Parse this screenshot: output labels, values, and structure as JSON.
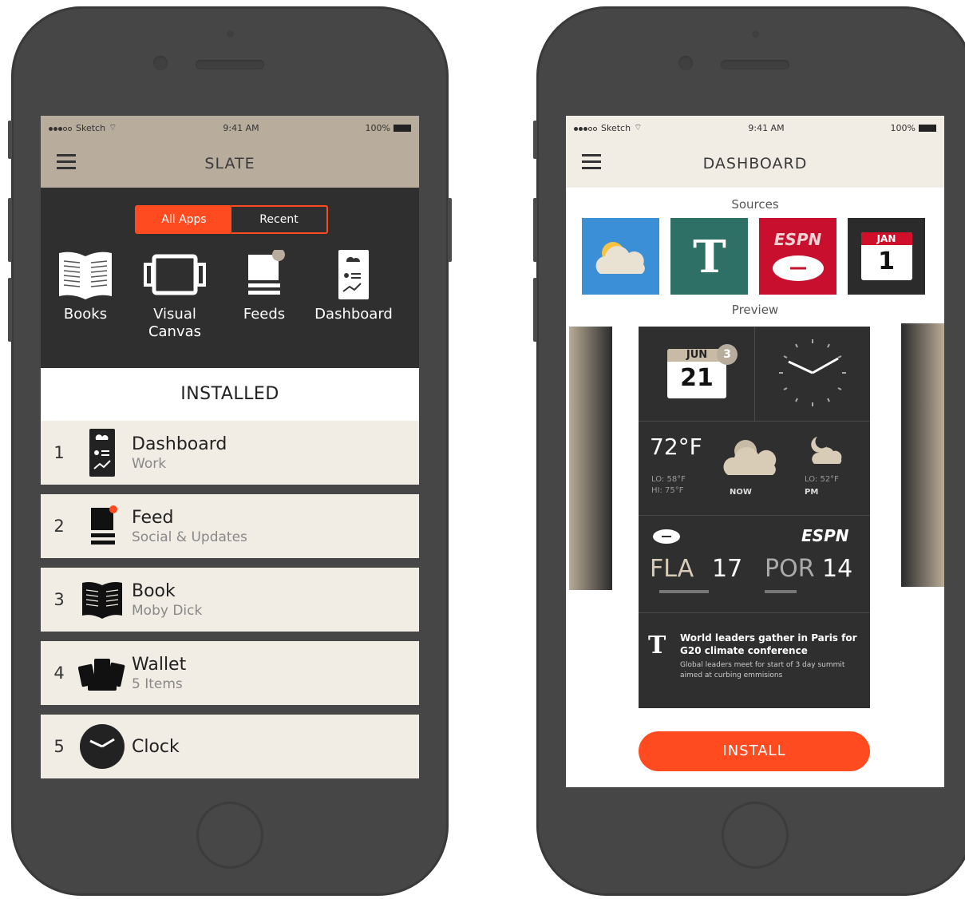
{
  "left_phone": {
    "status": {
      "carrier": "Sketch",
      "time": "9:41 AM",
      "battery": "100%"
    },
    "title": "SLATE",
    "segment": {
      "all_apps": "All Apps",
      "recent": "Recent"
    },
    "apps": [
      {
        "label": "Books",
        "icon": "open-book-icon"
      },
      {
        "label": "Visual Canvas",
        "icon": "canvas-frame-icon"
      },
      {
        "label": "Feeds",
        "icon": "feed-stack-icon"
      },
      {
        "label": "Dashboard",
        "icon": "dashboard-card-icon"
      }
    ],
    "installed_heading": "INSTALLED",
    "installed": [
      {
        "num": "1",
        "title": "Dashboard",
        "subtitle": "Work",
        "icon": "dashboard-card-icon"
      },
      {
        "num": "2",
        "title": "Feed",
        "subtitle": "Social & Updates",
        "icon": "feed-stack-icon"
      },
      {
        "num": "3",
        "title": "Book",
        "subtitle": "Moby Dick",
        "icon": "open-book-icon"
      },
      {
        "num": "4",
        "title": "Wallet",
        "subtitle": "5 Items",
        "icon": "wallet-cards-icon"
      },
      {
        "num": "5",
        "title": "Clock",
        "subtitle": "",
        "icon": "clock-icon"
      }
    ],
    "colors": {
      "accent": "#ff4b1f",
      "topbar": "#b8ad9d",
      "panel": "#2f2f2f",
      "row": "#f1ede4"
    }
  },
  "right_phone": {
    "status": {
      "carrier": "Sketch",
      "time": "9:41 AM",
      "battery": "100%"
    },
    "title": "DASHBOARD",
    "sources_label": "Sources",
    "sources": [
      {
        "name": "weather",
        "icon": "weather-cloud-icon",
        "color": "#3b8fd6"
      },
      {
        "name": "nytimes",
        "icon": "nyt-logo-icon",
        "color": "#2f7066"
      },
      {
        "name": "espn",
        "icon": "espn-football-icon",
        "color": "#c8102e",
        "text": "ESPN"
      },
      {
        "name": "calendar",
        "icon": "calendar-icon",
        "color": "#2b2b2b",
        "month": "JAN",
        "day": "1"
      }
    ],
    "preview_label": "Preview",
    "preview": {
      "calendar": {
        "month": "JUN",
        "day": "21",
        "badge": "3"
      },
      "weather": {
        "temp": "72°F",
        "lo": "LO: 58°F",
        "hi": "HI: 75°F",
        "now": "NOW",
        "pm_lo": "LO: 52°F",
        "pm": "PM"
      },
      "score": {
        "brand": "ESPN",
        "team1": "FLA",
        "score1": "17",
        "team2": "POR",
        "score2": "14"
      },
      "news": {
        "headline": "World leaders gather in Paris for G20 climate conference",
        "summary": "Global leaders meet for start of 3 day summit aimed at curbing emmisions"
      }
    },
    "install_label": "INSTALL"
  }
}
